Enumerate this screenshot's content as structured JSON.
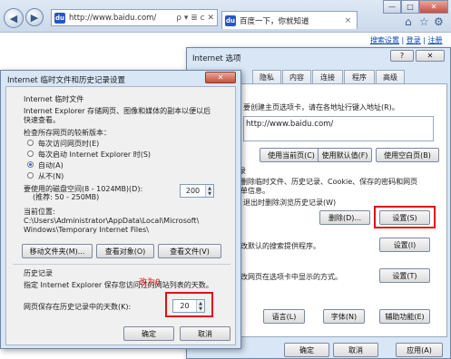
{
  "browser": {
    "url": "http://www.baidu.com/",
    "address_tools": "ρ ▾ ≣ c ✕",
    "tab_title": "百度一下，你就知道",
    "tab_close": "×",
    "window_min": "—",
    "window_max": "□",
    "window_close": "✕"
  },
  "page": {
    "links": [
      "搜索设置",
      "登录",
      "注册"
    ]
  },
  "internet_options": {
    "title": "Internet 选项",
    "help": "?",
    "close": "✕",
    "tabs": [
      "隐私",
      "内容",
      "连接",
      "程序",
      "高级"
    ],
    "home_text": "要创建主页选项卡，请在各地址行键入地址(R)。",
    "home_url": "http://www.baidu.com/",
    "home_buttons": [
      "使用当前页(C)",
      "使用默认值(F)",
      "使用空白页(B)"
    ],
    "history_head": "录",
    "history_text1": "删除临时文件、历史记录、Cookie、保存的密码和网页",
    "history_text2": "单信息。",
    "history_check": "退出时删除浏览历史记录(W)",
    "delete_button": "删除(D)...",
    "settings_button": "设置(S)",
    "search_text": "改默认的搜索提供程序。",
    "search_settings": "设置(I)",
    "tabs_text": "改网页在选项卡中显示的方式。",
    "tabs_settings": "设置(T)",
    "appearance_buttons": [
      "语言(L)",
      "字体(N)",
      "辅助功能(E)"
    ],
    "footer_buttons": [
      "确定",
      "取消",
      "应用(A)"
    ]
  },
  "temp_files_dialog": {
    "title": "Internet 临时文件和历史记录设置",
    "close": "✕",
    "section_temp": "Internet 临时文件",
    "desc1": "Internet Explorer 存储网页、图像和媒体的副本以便以后",
    "desc2": "快速查看。",
    "check_label": "检查所存网页的较新版本：",
    "radio_options": [
      "每次访问网页时(E)",
      "每次启动 Internet Explorer 时(S)",
      "自动(A)",
      "从不(N)"
    ],
    "radio_selected_index": 2,
    "disk_label1": "要使用的磁盘空间(8 - 1024MB)(D):",
    "disk_label2": "(推荐: 50 - 250MB)",
    "disk_value": "200",
    "location_label": "当前位置:",
    "location_path1": "C:\\Users\\Administrator\\AppData\\Local\\Microsoft\\",
    "location_path2": "Windows\\Temporary Internet Files\\",
    "buttons": [
      "移动文件夹(M)...",
      "查看对象(O)",
      "查看文件(V)"
    ],
    "section_history": "历史记录",
    "history_desc": "指定 Internet Explorer 保存您访问过的网站列表的天数。",
    "days_label": "网页保存在历史记录中的天数(K):",
    "days_value": "20",
    "overlay_text": "改为0",
    "ok": "确定",
    "cancel": "取消"
  },
  "colors": {
    "highlight": "#e01010",
    "dialog_frame": "#d8e6f5",
    "link": "#0b43b4"
  }
}
